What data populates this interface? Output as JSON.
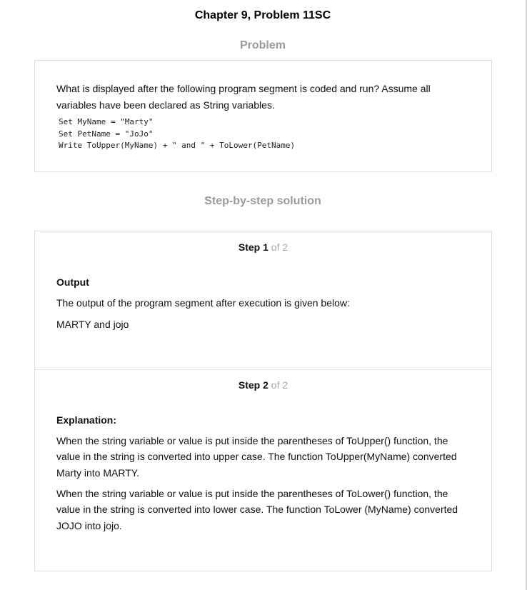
{
  "page": {
    "title": "Chapter 9, Problem 11SC"
  },
  "problem": {
    "heading": "Problem",
    "text": "What is displayed after the following program segment is coded and run? Assume all variables have been declared as String variables.",
    "code": "Set MyName = \"Marty\"\nSet PetName = \"JoJo\"\nWrite ToUpper(MyName) + \" and \" + ToLower(PetName)"
  },
  "solution": {
    "heading": "Step-by-step solution",
    "step_word": "Step",
    "steps": [
      {
        "number": "1",
        "of_text": "of 2",
        "label": "Output",
        "paragraphs": [
          "The output of the program segment after execution is given below:",
          "MARTY and jojo"
        ]
      },
      {
        "number": "2",
        "of_text": "of 2",
        "label": "Explanation:",
        "paragraphs": [
          "When the string variable or value is put inside the parentheses of ToUpper() function, the value in the string is converted into upper case. The function ToUpper(MyName) converted Marty into MARTY.",
          "When the string variable or value is put inside the parentheses of ToLower() function, the value in the string is converted into lower case. The function ToLower (MyName) converted JOJO into jojo."
        ]
      }
    ]
  }
}
